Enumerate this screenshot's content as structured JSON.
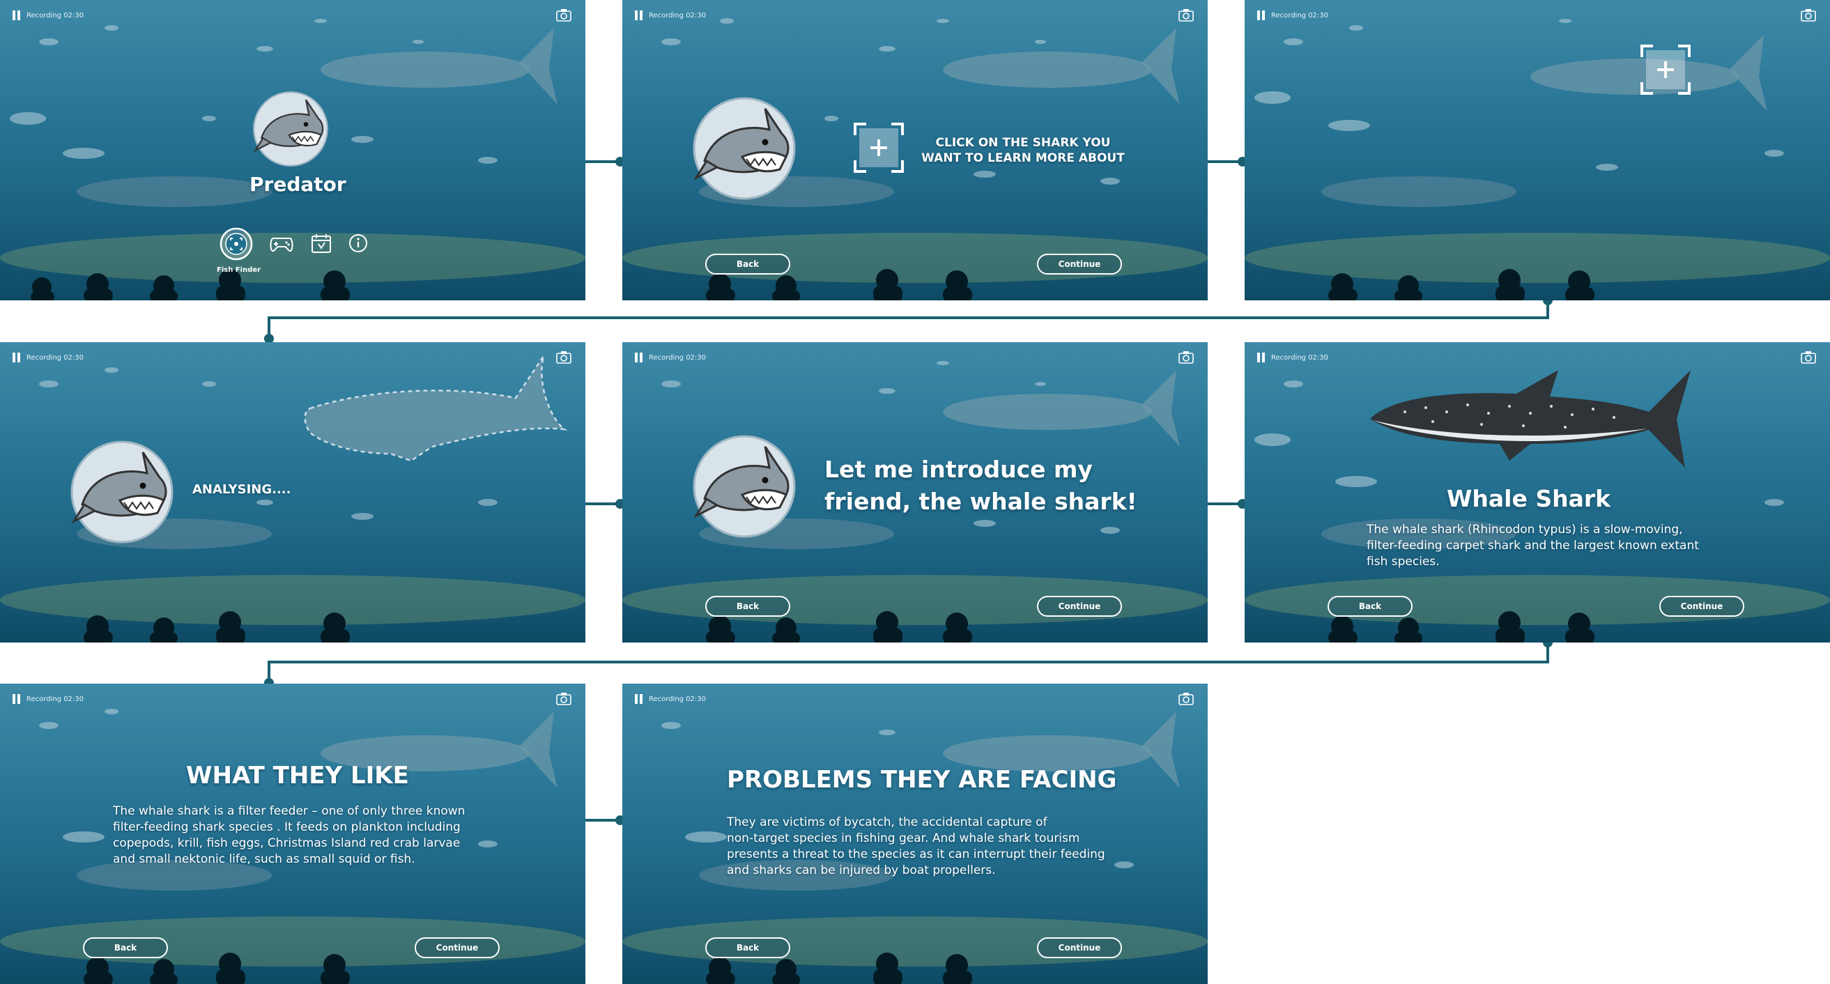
{
  "recording_label": "Recording 02:30",
  "buttons": {
    "back": "Back",
    "continue": "Continue"
  },
  "colors": {
    "connector": "#1a6070",
    "ocean_top": "#3e8aa8",
    "ocean_bottom": "#0e4a64"
  },
  "icons": [
    "pause-icon",
    "camera-icon",
    "fish-finder-icon",
    "gamepad-icon",
    "calendar-icon",
    "info-icon",
    "add-target-icon",
    "shark-mascot",
    "whale-shark-image"
  ],
  "screens": {
    "s1": {
      "title": "Predator",
      "menu_active_label": "Fish Finder"
    },
    "s2": {
      "instruction_line1": "CLICK ON THE SHARK YOU",
      "instruction_line2": "WANT TO LEARN MORE ABOUT"
    },
    "s4": {
      "status": "ANALYSING...."
    },
    "s5": {
      "intro_line1": "Let me introduce my",
      "intro_line2": "friend, the whale shark!"
    },
    "s6": {
      "title": "Whale Shark",
      "line1": "The whale shark (Rhincodon typus) is a slow-moving,",
      "line2": "filter-feeding carpet shark and the largest known extant",
      "line3": "fish species."
    },
    "s7": {
      "title": "WHAT THEY LIKE",
      "line1": "The whale shark is a filter feeder – one of only three known",
      "line2": "filter-feeding shark species . It feeds on plankton including",
      "line3": "copepods, krill, fish eggs, Christmas Island red crab larvae",
      "line4": "and small nektonic life, such as small squid or fish."
    },
    "s8": {
      "title": "PROBLEMS THEY ARE FACING",
      "line1": "They are victims of bycatch, the accidental capture of",
      "line2": "non-target species in fishing gear. And whale shark tourism",
      "line3": "presents a threat to the species as it can interrupt their feeding",
      "line4": "and sharks can be injured by boat propellers."
    }
  }
}
